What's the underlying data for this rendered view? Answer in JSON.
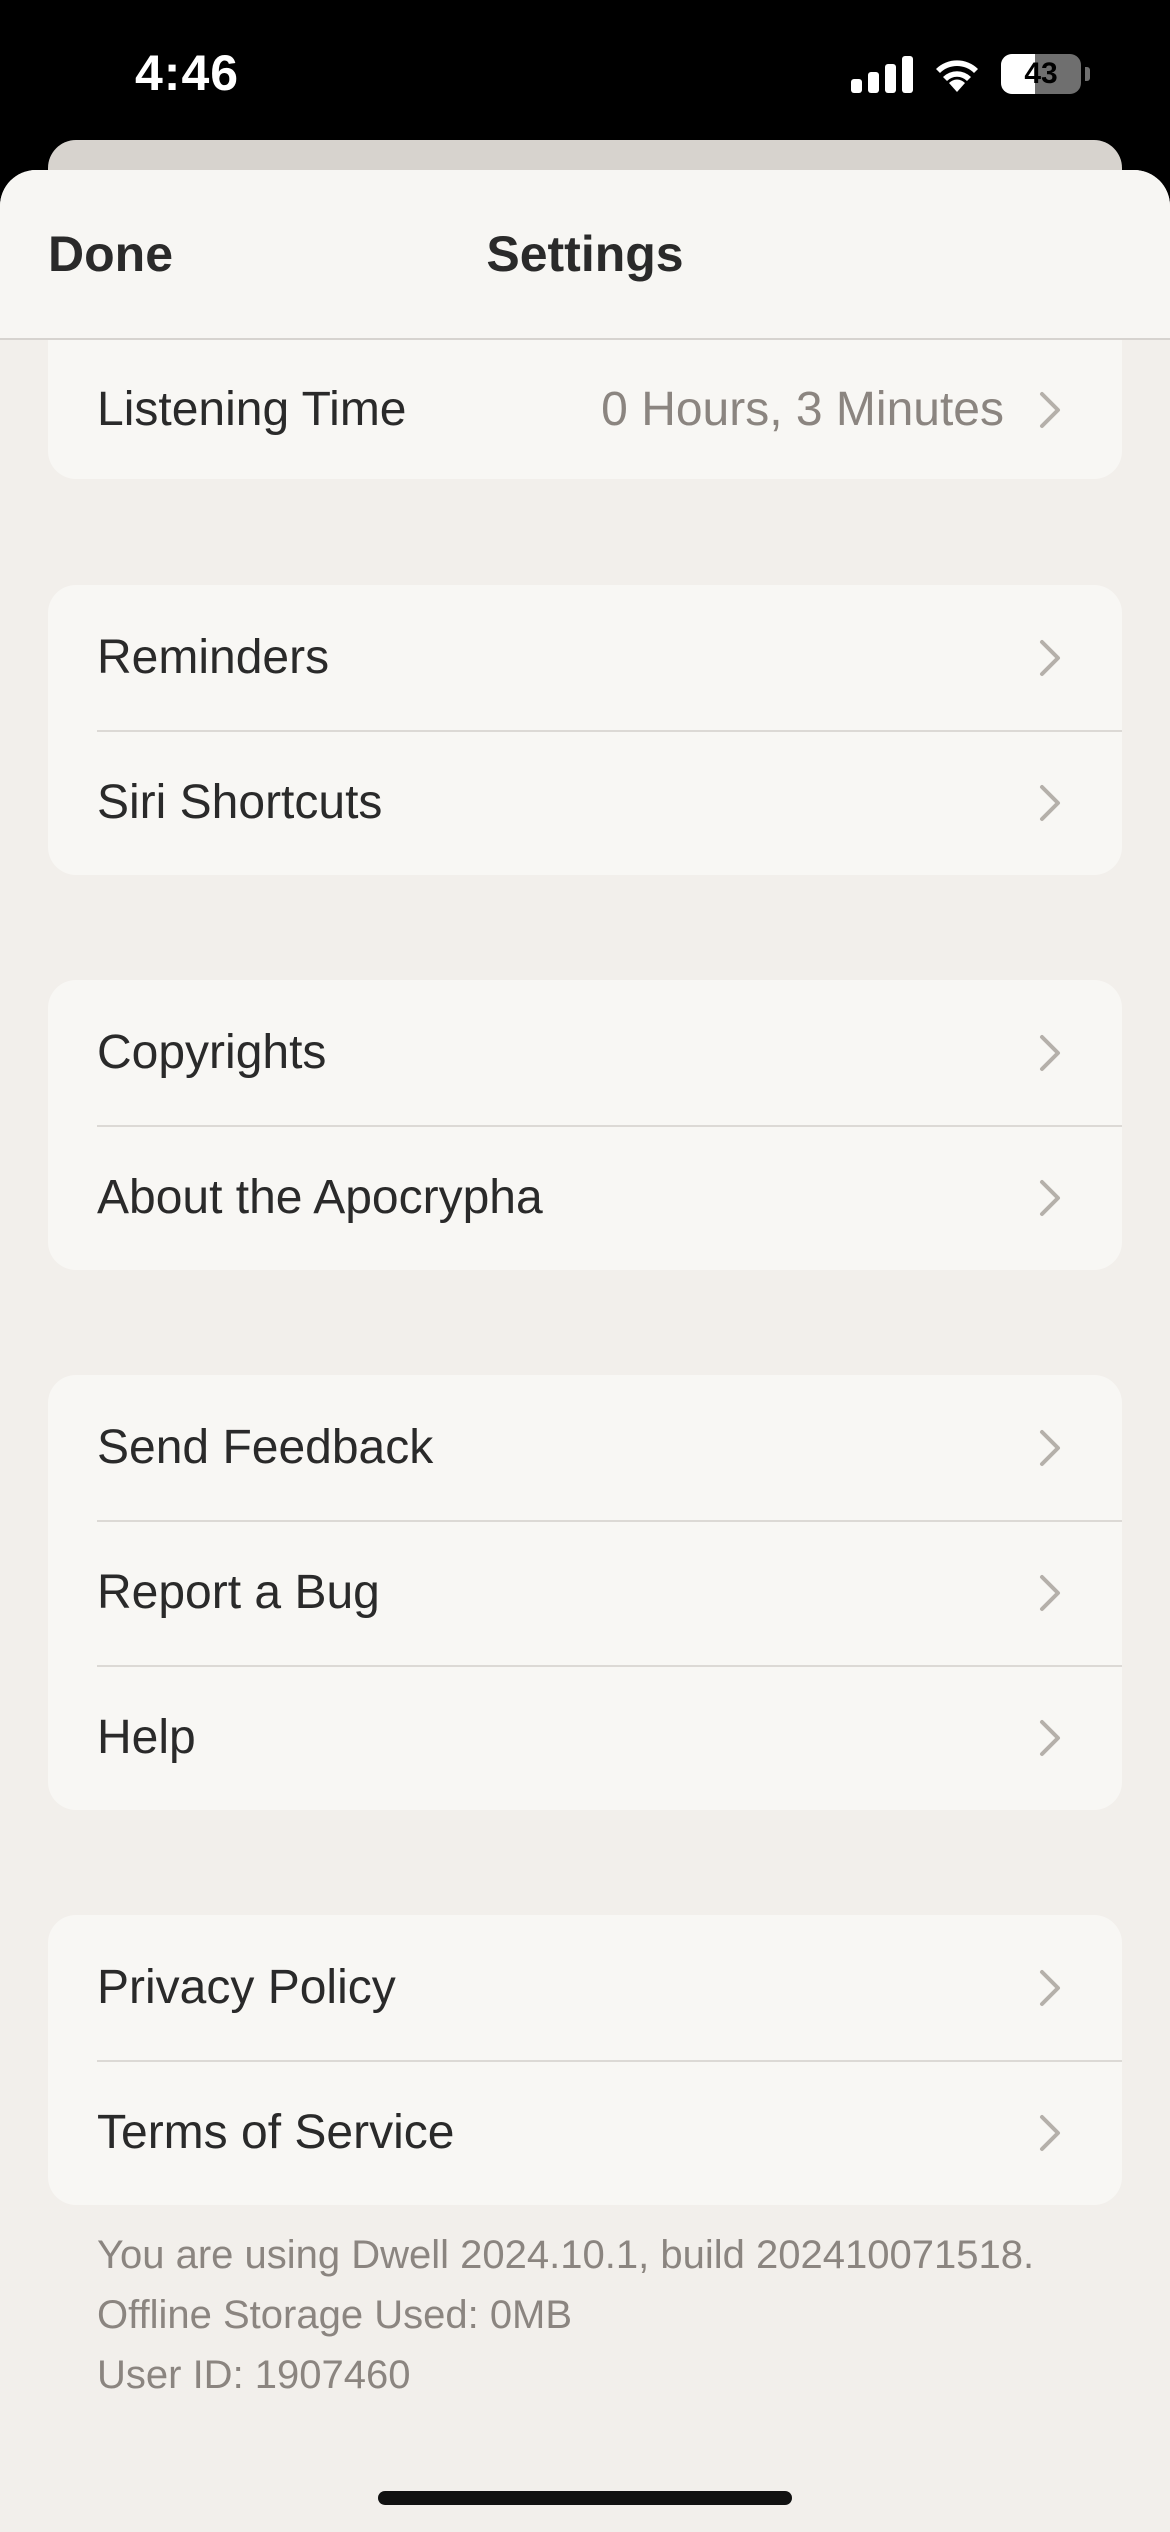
{
  "status_bar": {
    "time": "4:46",
    "battery_level": "43",
    "icons": [
      "cellular-signal-icon",
      "wifi-icon",
      "battery-icon"
    ]
  },
  "nav": {
    "done_label": "Done",
    "title": "Settings"
  },
  "groups": [
    {
      "rows": [
        {
          "label": "Listening Time",
          "value": "0 Hours, 3 Minutes"
        }
      ]
    },
    {
      "rows": [
        {
          "label": "Reminders"
        },
        {
          "label": "Siri Shortcuts"
        }
      ]
    },
    {
      "rows": [
        {
          "label": "Copyrights"
        },
        {
          "label": "About the Apocrypha"
        }
      ]
    },
    {
      "rows": [
        {
          "label": "Send Feedback"
        },
        {
          "label": "Report a Bug"
        },
        {
          "label": "Help"
        }
      ]
    },
    {
      "rows": [
        {
          "label": "Privacy Policy"
        },
        {
          "label": "Terms of Service"
        }
      ]
    }
  ],
  "footer": {
    "version_line": "You are using Dwell 2024.10.1, build 202410071518.",
    "storage_line": "Offline Storage Used: 0MB",
    "user_line": "User ID: 1907460"
  },
  "colors": {
    "background": "#f2efeb",
    "row_background": "#f8f7f4",
    "text": "#2a2a2a",
    "secondary_text": "#8b8580"
  }
}
